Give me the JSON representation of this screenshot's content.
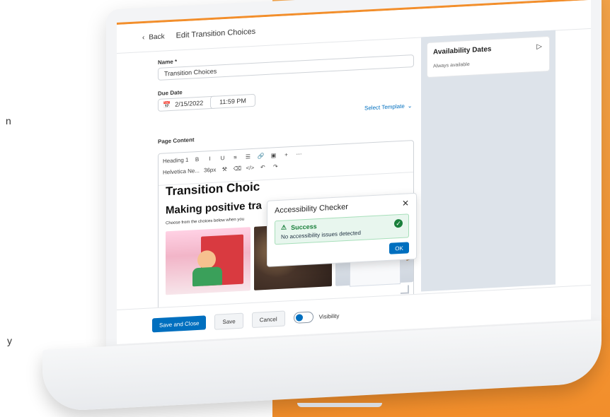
{
  "page": {
    "left_edge_chars": [
      "n",
      "y"
    ]
  },
  "app": {
    "back_label": "Back",
    "title": "Edit Transition Choices"
  },
  "form": {
    "name_label": "Name *",
    "name_value": "Transition Choices",
    "due_label": "Due Date",
    "due_date": "2/15/2022",
    "due_time": "11:59 PM",
    "select_template": "Select Template",
    "page_content_label": "Page Content"
  },
  "editor": {
    "toolbar": {
      "heading": "Heading 1",
      "font": "Helvetica Ne...",
      "size": "36px",
      "bold": "B",
      "italic": "I",
      "underline": "U",
      "more": "⋯"
    },
    "content": {
      "title": "Transition Choic",
      "subtitle": "Making positive tra",
      "instruction": "Choose from the choices below when you"
    }
  },
  "modal": {
    "title": "Accessibility Checker",
    "success_title": "Success",
    "success_message": "No accessibility issues detected",
    "ok_label": "OK"
  },
  "right_panel": {
    "title": "Availability Dates",
    "subtitle": "Always available"
  },
  "actions": {
    "save_close": "Save and Close",
    "save": "Save",
    "cancel": "Cancel",
    "visibility": "Visibility"
  },
  "icons": {
    "back": "chevron-left-icon",
    "calendar": "calendar-icon",
    "chevron_down": "chevron-down-icon",
    "close": "close-icon",
    "check": "check-icon",
    "panel_toggle": "play-icon",
    "resize": "resize-icon"
  },
  "colors": {
    "accent": "#006fbf",
    "orange": "#f28e2b",
    "success": "#1a7f3b"
  }
}
